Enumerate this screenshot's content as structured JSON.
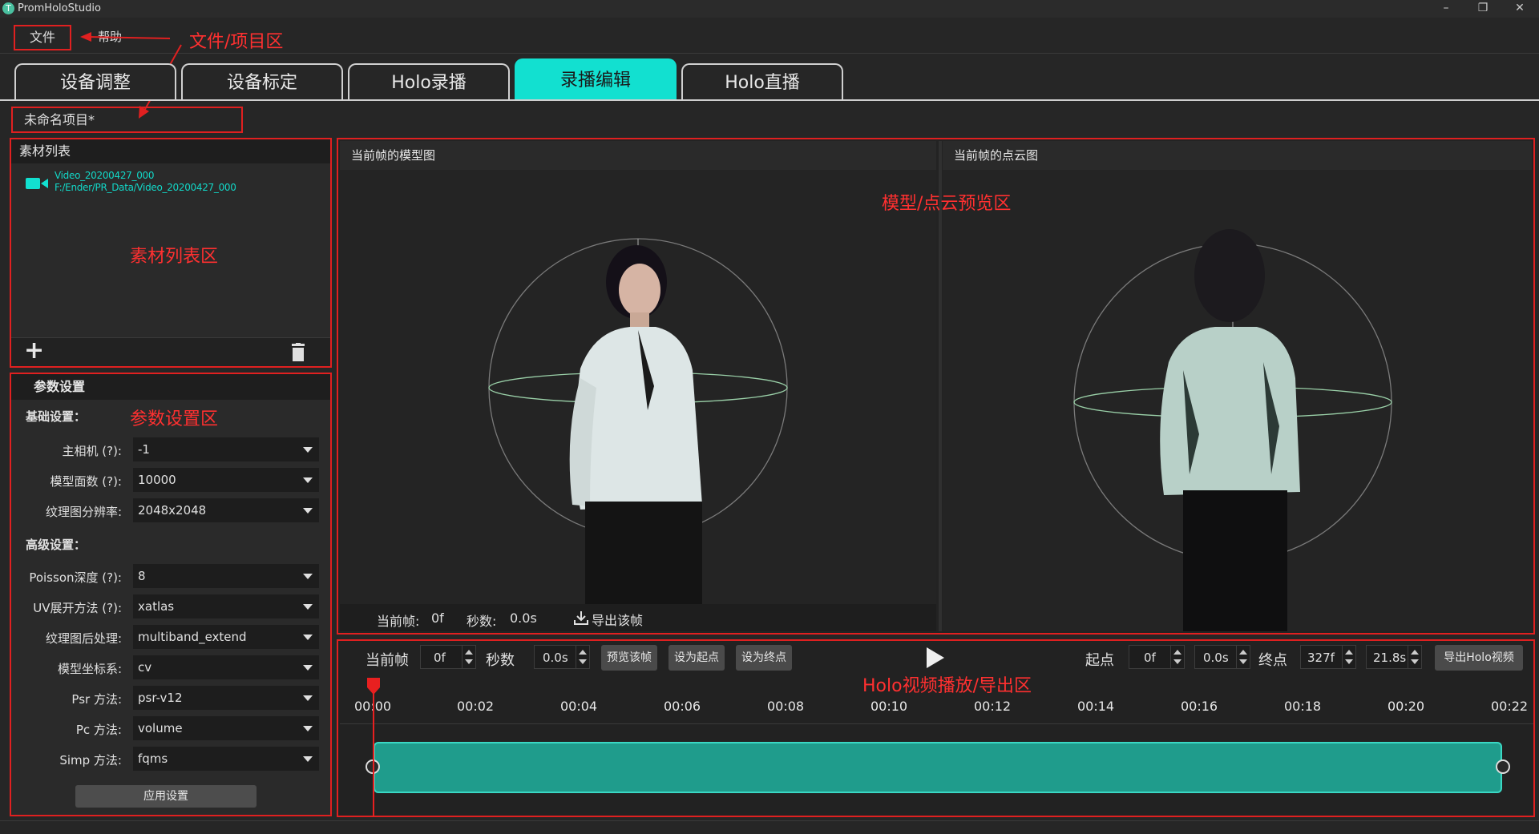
{
  "window": {
    "title": "PromHoloStudio",
    "logo_letter": "T"
  },
  "menu": {
    "file": "文件",
    "help": "帮助"
  },
  "annotations": {
    "file_area": "文件/项目区",
    "material_list_area": "素材列表区",
    "params_area": "参数设置区",
    "preview_area": "模型/点云预览区",
    "playback_area": "Holo视频播放/导出区"
  },
  "tabs": [
    {
      "label": "设备调整"
    },
    {
      "label": "设备标定"
    },
    {
      "label": "Holo录播"
    },
    {
      "label": "录播编辑"
    },
    {
      "label": "Holo直播"
    }
  ],
  "project": {
    "name": "未命名项目*"
  },
  "materials": {
    "header": "素材列表",
    "items": [
      {
        "name": "Video_20200427_000",
        "path": "F:/Ender/PR_Data/Video_20200427_000"
      }
    ]
  },
  "params": {
    "header": "参数设置",
    "basic_title": "基础设置：",
    "advanced_title": "高级设置：",
    "basic": [
      {
        "label": "主相机 (?):",
        "value": "-1"
      },
      {
        "label": "模型面数 (?):",
        "value": "10000"
      },
      {
        "label": "纹理图分辨率:",
        "value": "2048x2048"
      }
    ],
    "advanced": [
      {
        "label": "Poisson深度 (?):",
        "value": "8"
      },
      {
        "label": "UV展开方法 (?):",
        "value": "xatlas"
      },
      {
        "label": "纹理图后处理:",
        "value": "multiband_extend"
      },
      {
        "label": "模型坐标系:",
        "value": "cv"
      },
      {
        "label": "Psr 方法:",
        "value": "psr-v12"
      },
      {
        "label": "Pc 方法:",
        "value": "volume"
      },
      {
        "label": "Simp 方法:",
        "value": "fqms"
      }
    ],
    "apply_label": "应用设置"
  },
  "preview": {
    "model_title": "当前帧的模型图",
    "cloud_title": "当前帧的点云图",
    "cur_frame_label": "当前帧:",
    "cur_frame_value": "0f",
    "seconds_label": "秒数:",
    "seconds_value": "0.0s",
    "export_frame": "导出该帧"
  },
  "playback": {
    "cur_frame_label": "当前帧",
    "cur_frame_value": "0f",
    "seconds_label": "秒数",
    "seconds_value": "0.0s",
    "preview_btn": "预览该帧",
    "set_start_btn": "设为起点",
    "set_end_btn": "设为终点",
    "start_label": "起点",
    "start_frame": "0f",
    "start_seconds": "0.0s",
    "end_label": "终点",
    "end_frame": "327f",
    "end_seconds": "21.8s",
    "export_btn": "导出Holo视频",
    "ticks": [
      "00:00",
      "00:02",
      "00:04",
      "00:06",
      "00:08",
      "00:10",
      "00:12",
      "00:14",
      "00:16",
      "00:18",
      "00:20",
      "00:22"
    ]
  },
  "colors": {
    "accent": "#12e0d0",
    "annotation": "#e02020",
    "clip": "#1e9a8a"
  }
}
